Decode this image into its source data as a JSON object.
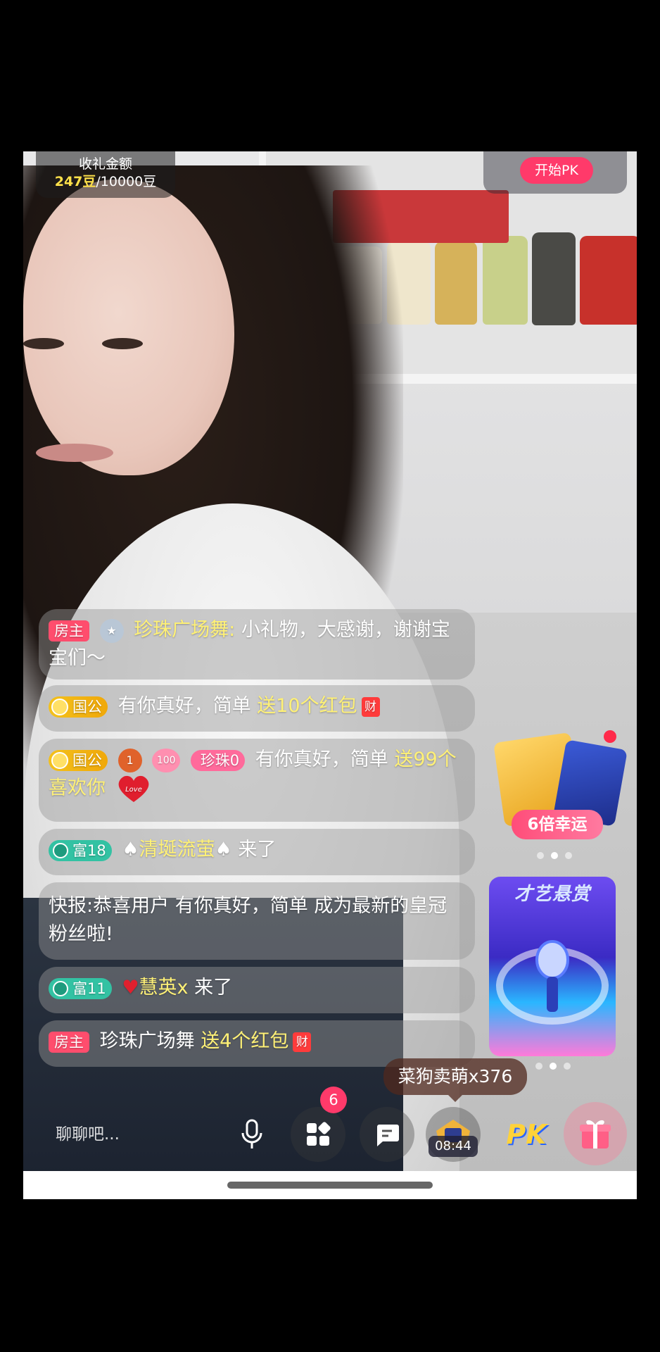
{
  "colors": {
    "accent_pink": "#ff3a6a",
    "gold_text": "#fff176",
    "host_tag": "#ff4d6d",
    "rich_tag": "#33c2a3"
  },
  "top": {
    "gift_title": "收礼金额",
    "gift_current": "247豆",
    "gift_target": "/10000豆",
    "pk_button": "开始PK"
  },
  "chat": [
    {
      "tag": "房主",
      "name": "珍珠广场舞:",
      "text": "小礼物，大感谢，谢谢宝宝们～"
    },
    {
      "tag": "国公",
      "name": "有你真好，简单",
      "text": "送10个红包",
      "icon": "财"
    },
    {
      "tag": "国公",
      "level": "1",
      "tag2": "100",
      "tag3": "珍珠0",
      "name": "有你真好，简单",
      "text": "送99个喜欢你",
      "heart_label": "Love"
    },
    {
      "tag": "富18",
      "name": "清埏流萤",
      "text": "来了"
    },
    {
      "prefix": "快报:",
      "text": "恭喜用户 有你真好，简单 成为最新的皇冠粉丝啦!"
    },
    {
      "tag": "富11",
      "name": "慧英x",
      "text": "来了"
    },
    {
      "tag": "房主",
      "name": "珍珠广场舞",
      "text": "送4个红包",
      "icon": "财"
    }
  ],
  "side": {
    "lucky_label": "6倍幸运",
    "promo2_title": "才艺悬赏",
    "gift_popup": "菜狗卖萌x376"
  },
  "bottom": {
    "chat_placeholder": "聊聊吧...",
    "notification_count": "6",
    "timer": "08:44",
    "pk_label": "PK"
  }
}
